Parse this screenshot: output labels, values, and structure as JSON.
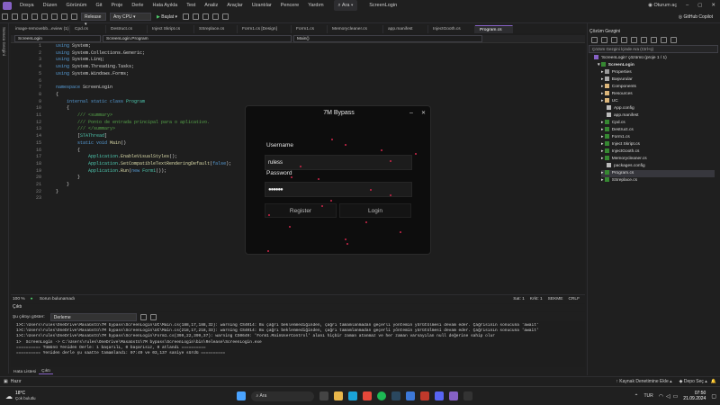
{
  "menu": {
    "items": [
      "Dosya",
      "Düzen",
      "Görünüm",
      "Git",
      "Proje",
      "Derle",
      "Hata Ayıkla",
      "Test",
      "Analiz",
      "Araçlar",
      "Uzantılar",
      "Pencere",
      "Yardım"
    ],
    "search": "Ara",
    "project": "ScreenLogin",
    "account": "Oturum aç",
    "copilot": "GitHub Copilot"
  },
  "toolbar": {
    "config": "Release",
    "platform": "Any CPU",
    "start": "Başlat"
  },
  "left_tab": "Sunucu Gezgini",
  "doc_tabs": [
    "image-removebb...eview (1).png",
    "Cpd.cs",
    "Destruct.cs",
    "Inject Skript.cs",
    "SSreplace.cs",
    "Form1.cs [Design]",
    "Form1.cs",
    "Memorycleaner.cs",
    "app.manifest",
    "InjectGooth.cs",
    "Program.cs"
  ],
  "nav": {
    "project": "ScreenLogin",
    "class": "ScreenLogin.Program",
    "member": "Main()"
  },
  "line_numbers": [
    "1",
    "2",
    "3",
    "4",
    "5",
    "6",
    "7",
    "8",
    "9",
    "10",
    "11",
    "12",
    "13",
    "14",
    "15",
    "16",
    "17",
    "18",
    "19",
    "20",
    "21",
    "22",
    "23"
  ],
  "editor_status": {
    "zoom": "100 %",
    "issues": "Sorun bulunamadı",
    "line": "Sat: 1",
    "col": "Krkt: 1",
    "tab": "SEKME",
    "eol": "CRLF"
  },
  "output": {
    "title": "Çıktı",
    "show_label": "Şu çıktıyı göster:",
    "source": "Derleme",
    "lines": [
      "1>C:\\Users\\rules\\OneDrive\\Masaüstü\\7M bypass\\ScreenLogin\\UC\\Main.cs(188,17,188,32): warning CS4014: Bu çağrı beklenmediğinden, çağrı tamamlanmadan geçerli yöntemin yürütülmesi devam eder. Çağrısının sonucuna 'await'",
      "1>C:\\Users\\rules\\OneDrive\\Masaüstü\\7M bypass\\ScreenLogin\\UC\\Main.cs(218,17,218,33): warning CS4014: Bu çağrı beklenmediğinden, çağrı tamamlanmadan geçerli yöntemin yürütülmesi devam eder. Çağrısının sonucuna 'await'",
      "1>C:\\Users\\rules\\OneDrive\\Masaüstü\\7M bypass\\ScreenLogin\\Form1.cs(399,22,399,37): warning CS0649: 'Form1.MainUserControl' alanı hiçbir zaman atanmaz ve her zaman varsayılan null değerine sahip olur",
      "1>  ScreenLogin -> C:\\Users\\rules\\OneDrive\\Masaüstü\\7M bypass\\ScreenLogin\\bin\\Release\\ScreenLogin.exe",
      "========== Tümünü Yeniden Derle: 1 başarılı, 0 başarısız, 0 atlandı ==========",
      "========== Yeniden derle şu saatte tamamlandı: 07:49 ve 03,137 saniye sürdü =========="
    ]
  },
  "bottom_tabs": [
    "Hata Listesi",
    "Çıktı"
  ],
  "solution": {
    "title": "Çözüm Gezgini",
    "search": "Çözüm Gezgini İçinde Ara (Ctrl+ş)",
    "root": "'ScreenLogin' çözümü (proje 1 / 1)",
    "project": "ScreenLogin",
    "items": [
      "Properties",
      "Başvurular",
      "Components",
      "Resources",
      "UC",
      "App.config",
      "app.manifest",
      "Cpd.cs",
      "Destruct.cs",
      "Form1.cs",
      "Inject Skript.cs",
      "InjectGooth.cs",
      "Memorycleaner.cs",
      "packages.config",
      "Program.cs",
      "SSreplace.cs"
    ]
  },
  "status": {
    "left": "Hazır",
    "source_control": "Kaynak Denetimine Ekle",
    "repo": "Depo Seç"
  },
  "taskbar": {
    "temp": "18°C",
    "weather": "Çok bulutlu",
    "search": "Ara",
    "lang": "TUR",
    "time": "07:50",
    "date": "21.09.2024"
  },
  "dialog": {
    "title": "7M Bypass",
    "username_label": "Username",
    "username_value": "ruless",
    "password_label": "Password",
    "password_value": "●●●●●●",
    "register": "Register",
    "login": "Login",
    "minimize": "–",
    "close": "✕"
  },
  "colors": {
    "accent": "#8661c5",
    "dots": "#d0264a",
    "bg": "#1f1f1f",
    "editor": "#1e1e1e"
  }
}
